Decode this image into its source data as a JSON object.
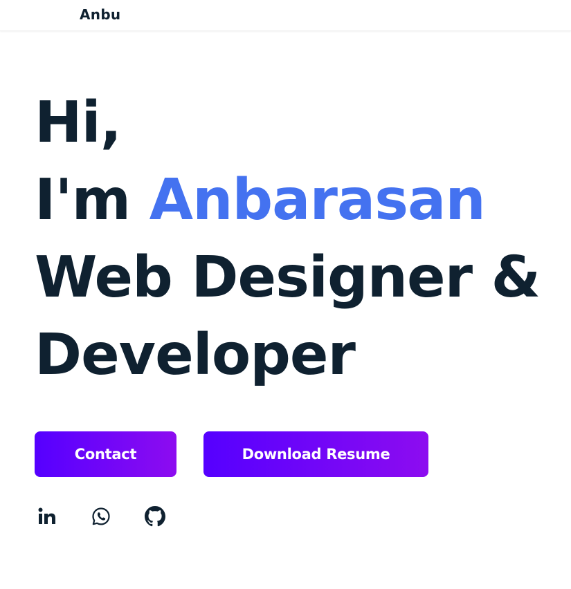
{
  "nav": {
    "brand": "Anbu"
  },
  "hero": {
    "greeting": "Hi,",
    "intro_prefix": "I'm ",
    "name": "Anbarasan",
    "role_line1": "Web Designer &",
    "role_line2": "Developer"
  },
  "buttons": {
    "contact_label": "Contact",
    "resume_label": "Download Resume"
  },
  "social": [
    {
      "icon": "linkedin-icon"
    },
    {
      "icon": "whatsapp-icon"
    },
    {
      "icon": "github-icon"
    }
  ],
  "colors": {
    "text": "#0f2130",
    "accent_name": "#4472f0",
    "button_gradient_start": "#5500ff",
    "button_gradient_end": "#8d0cf0"
  }
}
